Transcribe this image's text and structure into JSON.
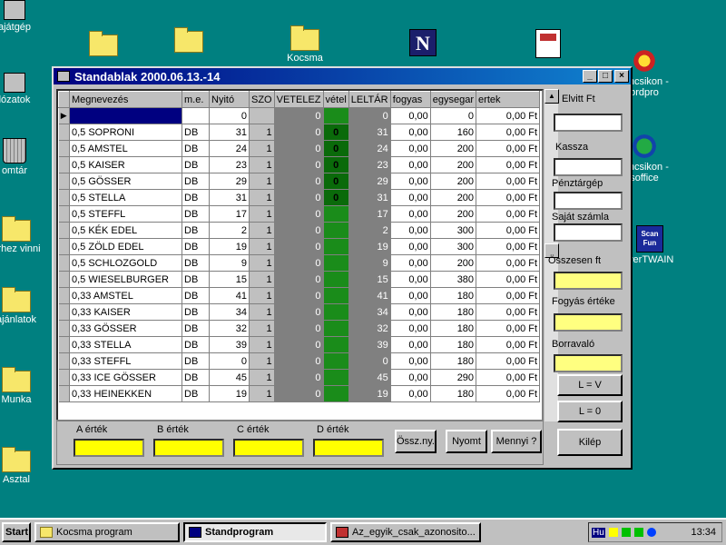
{
  "desktop": {
    "icons_left": [
      {
        "label": "ajátgép",
        "glyph": "computer-icon"
      },
      {
        "label": "lózatok",
        "glyph": "network-icon"
      },
      {
        "label": "omtár",
        "glyph": "recycle-bin-icon"
      },
      {
        "label": "erhez vinni",
        "glyph": "folder-icon"
      },
      {
        "label": "ajánlatok",
        "glyph": "folder-icon"
      },
      {
        "label": "Munka",
        "glyph": "folder-icon"
      },
      {
        "label": "Asztal",
        "glyph": "folder-icon"
      }
    ],
    "icons_right": [
      {
        "label_line1": "rancsikon -",
        "label_line2": "ordpro"
      },
      {
        "label_line1": "rancsikon -",
        "label_line2": "soffice"
      },
      {
        "label_line1": "werTWAIN",
        "label_line2": ""
      }
    ],
    "scanfun_text": "Scan Fun",
    "top_icon_labels": [
      "Kocsma"
    ]
  },
  "window": {
    "title": "Standablak 2000.06.13.-14",
    "controls": {
      "minimize": "_",
      "maximize": "□",
      "close": "×"
    }
  },
  "grid": {
    "columns": [
      "Megnevezés",
      "m.e.",
      "Nyitó",
      "SZO",
      "VETELEZ",
      "vétel",
      "LELTÁR",
      "fogyas",
      "egysegar",
      "ertek"
    ],
    "rows": [
      {
        "name": "",
        "me": "",
        "nyito": "0",
        "szo": "",
        "vetelez": "0",
        "vetel": "",
        "leltar": "0",
        "fogyas": "0,00",
        "egysegar": "0",
        "ertek": "0,00 Ft"
      },
      {
        "name": "0,5 SOPRONI",
        "me": "DB",
        "nyito": "31",
        "szo": "1",
        "vetelez": "0",
        "vetel": "0",
        "leltar": "31",
        "fogyas": "0,00",
        "egysegar": "160",
        "ertek": "0,00 Ft"
      },
      {
        "name": "0,5  AMSTEL",
        "me": "DB",
        "nyito": "24",
        "szo": "1",
        "vetelez": "0",
        "vetel": "0",
        "leltar": "24",
        "fogyas": "0,00",
        "egysegar": "200",
        "ertek": "0,00 Ft"
      },
      {
        "name": "0,5  KAISER",
        "me": "DB",
        "nyito": "23",
        "szo": "1",
        "vetelez": "0",
        "vetel": "0",
        "leltar": "23",
        "fogyas": "0,00",
        "egysegar": "200",
        "ertek": "0,00 Ft"
      },
      {
        "name": "0,5 GÖSSER",
        "me": "DB",
        "nyito": "29",
        "szo": "1",
        "vetelez": "0",
        "vetel": "0",
        "leltar": "29",
        "fogyas": "0,00",
        "egysegar": "200",
        "ertek": "0,00 Ft"
      },
      {
        "name": "0,5 STELLA",
        "me": "DB",
        "nyito": "31",
        "szo": "1",
        "vetelez": "0",
        "vetel": "0",
        "leltar": "31",
        "fogyas": "0,00",
        "egysegar": "200",
        "ertek": "0,00 Ft"
      },
      {
        "name": "0,5 STEFFL",
        "me": "DB",
        "nyito": "17",
        "szo": "1",
        "vetelez": "0",
        "vetel": "",
        "leltar": "17",
        "fogyas": "0,00",
        "egysegar": "200",
        "ertek": "0,00 Ft"
      },
      {
        "name": "0,5 KÉK EDEL",
        "me": "DB",
        "nyito": "2",
        "szo": "1",
        "vetelez": "0",
        "vetel": "",
        "leltar": "2",
        "fogyas": "0,00",
        "egysegar": "300",
        "ertek": "0,00 Ft"
      },
      {
        "name": "0,5 ZÖLD EDEL",
        "me": "DB",
        "nyito": "19",
        "szo": "1",
        "vetelez": "0",
        "vetel": "",
        "leltar": "19",
        "fogyas": "0,00",
        "egysegar": "300",
        "ertek": "0,00 Ft"
      },
      {
        "name": "0,5 SCHLOZGOLD",
        "me": "DB",
        "nyito": "9",
        "szo": "1",
        "vetelez": "0",
        "vetel": "",
        "leltar": "9",
        "fogyas": "0,00",
        "egysegar": "200",
        "ertek": "0,00 Ft"
      },
      {
        "name": "0,5 WIESELBURGER",
        "me": "DB",
        "nyito": "15",
        "szo": "1",
        "vetelez": "0",
        "vetel": "",
        "leltar": "15",
        "fogyas": "0,00",
        "egysegar": "380",
        "ertek": "0,00 Ft"
      },
      {
        "name": "0,33 AMSTEL",
        "me": "DB",
        "nyito": "41",
        "szo": "1",
        "vetelez": "0",
        "vetel": "",
        "leltar": "41",
        "fogyas": "0,00",
        "egysegar": "180",
        "ertek": "0,00 Ft"
      },
      {
        "name": "0,33 KAISER",
        "me": "DB",
        "nyito": "34",
        "szo": "1",
        "vetelez": "0",
        "vetel": "",
        "leltar": "34",
        "fogyas": "0,00",
        "egysegar": "180",
        "ertek": "0,00 Ft"
      },
      {
        "name": "0,33 GÖSSER",
        "me": "DB",
        "nyito": "32",
        "szo": "1",
        "vetelez": "0",
        "vetel": "",
        "leltar": "32",
        "fogyas": "0,00",
        "egysegar": "180",
        "ertek": "0,00 Ft"
      },
      {
        "name": "0,33 STELLA",
        "me": "DB",
        "nyito": "39",
        "szo": "1",
        "vetelez": "0",
        "vetel": "",
        "leltar": "39",
        "fogyas": "0,00",
        "egysegar": "180",
        "ertek": "0,00 Ft"
      },
      {
        "name": "0,33 STEFFL",
        "me": "DB",
        "nyito": "0",
        "szo": "1",
        "vetelez": "0",
        "vetel": "",
        "leltar": "0",
        "fogyas": "0,00",
        "egysegar": "180",
        "ertek": "0,00 Ft"
      },
      {
        "name": "0,33 ICE GÖSSER",
        "me": "DB",
        "nyito": "45",
        "szo": "1",
        "vetelez": "0",
        "vetel": "",
        "leltar": "45",
        "fogyas": "0,00",
        "egysegar": "290",
        "ertek": "0,00 Ft"
      },
      {
        "name": "0,33 HEINEKKEN",
        "me": "DB",
        "nyito": "19",
        "szo": "1",
        "vetelez": "0",
        "vetel": "",
        "leltar": "19",
        "fogyas": "0,00",
        "egysegar": "180",
        "ertek": "0,00 Ft"
      }
    ],
    "row_indicator": "▶"
  },
  "right_panel": {
    "elvitt_label": "Elvitt Ft",
    "kassza_label": "Kassza",
    "penztargep_label": "Pénztárgép",
    "sajat_szamla_label": "Saját számla",
    "osszesen_label": "Összesen ft",
    "fogyas_erteke_label": "Fogyás értéke",
    "borravalo_label": "Borravaló",
    "lv_button": "L = V",
    "l0_button": "L = 0",
    "kilep_button": "Kilép"
  },
  "bottom_panel": {
    "a_label": "A érték",
    "b_label": "B érték",
    "c_label": "C érték",
    "d_label": "D érték",
    "ossz_button": "Össz.ny.",
    "nyomt_button": "Nyomt",
    "mennyi_button": "Mennyi ?"
  },
  "taskbar": {
    "start_label": "Start",
    "tasks": [
      "Kocsma program",
      "Standprogram",
      "Az_egyik_csak_azonosito..."
    ],
    "active_task": "Standprogram",
    "language": "Hu",
    "clock": "13:34"
  },
  "colors": {
    "desktop": "#008080",
    "titlebar": "#000080",
    "vetel_green": "#1a8c1a",
    "field_yellow": "#ffff00"
  }
}
